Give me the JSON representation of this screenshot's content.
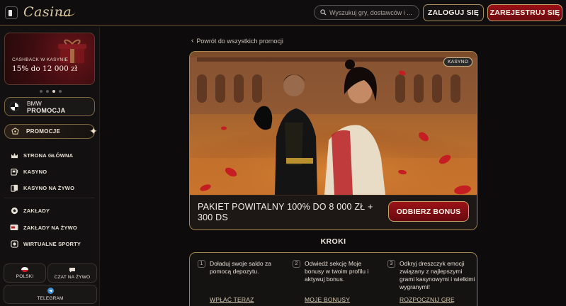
{
  "header": {
    "logo_text": "Casina",
    "search_placeholder": "Wyszukuj gry, dostawców i ...",
    "login_label": "ZALOGUJ SIĘ",
    "register_label": "ZAREJESTRUJ SIĘ",
    "icons": [
      "sidebar-toggle-icon",
      "search-icon"
    ]
  },
  "sidebar": {
    "promo_card": {
      "subtitle": "CASHBACK W KASYNIE",
      "title": "15% do 12 000 zł"
    },
    "carousel": {
      "count": 4,
      "active_index": 2
    },
    "bmw": {
      "line1": "BMW",
      "line2": "PROMOCJA"
    },
    "promocje_label": "PROMOCJE",
    "nav": [
      {
        "label": "STRONA GŁÓWNA",
        "icon": "crown-icon"
      },
      {
        "label": "KASYNO",
        "icon": "slot-machine-icon"
      },
      {
        "label": "KASYNO NA ŻYWO",
        "icon": "cards-icon"
      },
      {
        "label": "ZAKŁADY",
        "icon": "soccer-ball-icon"
      },
      {
        "label": "ZAKŁADY NA ŻYWO",
        "icon": "live-tv-icon"
      },
      {
        "label": "WIRTUALNE SPORTY",
        "icon": "virtual-sports-icon"
      }
    ],
    "footer": {
      "language_label": "POLSKI",
      "chat_label": "CZAT NA ŻYWO",
      "telegram_label": "TELEGRAM"
    }
  },
  "main": {
    "back_link": "Powrót do wszystkich promocji",
    "hero": {
      "badge": "KASYNO",
      "title": "PAKIET POWITALNY 100% DO 8 000 ZŁ + 300 DS",
      "claim_label": "ODBIERZ BONUS"
    },
    "steps_title": "KROKI",
    "steps": [
      {
        "num": "1",
        "text": "Doładuj swoje saldo za pomocą depozytu.",
        "link": "WPŁAĆ TERAZ"
      },
      {
        "num": "2",
        "text": "Odwiedź sekcję Moje bonusy w twoim profilu i aktywuj bonus.",
        "link": "MOJE BONUSY"
      },
      {
        "num": "3",
        "text": "Odkryj dreszczyk emocji związany z najlepszymi grami kasynowymi i wielkimi wygranymi!",
        "link": "ROZPOCZNIJ GRĘ"
      }
    ]
  },
  "colors": {
    "background": "#0d0b0b",
    "gold_border": "#a98a55",
    "brand_red": "#9b1318",
    "text_primary": "#f3eee6"
  }
}
